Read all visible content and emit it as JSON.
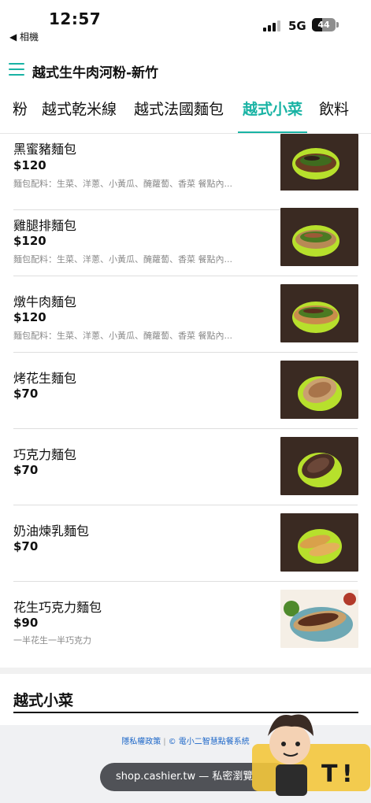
{
  "status_bar": {
    "time": "12:57",
    "back_label": "◀ 相機",
    "network": "5G",
    "battery": "44",
    "battery_level": 0.44
  },
  "header": {
    "title": "越式生牛肉河粉-新竹"
  },
  "tabs": [
    {
      "label": "粉",
      "active": false
    },
    {
      "label": "越式乾米線",
      "active": false
    },
    {
      "label": "越式法國麵包",
      "active": false
    },
    {
      "label": "越式小菜",
      "active": true
    },
    {
      "label": "飲料",
      "active": false
    }
  ],
  "items": [
    {
      "name": "黑蜜豬麵包",
      "price": "$120",
      "desc": "麵包配料：生菜、洋蔥、小黃瓜、醃蘿蔔、香菜 餐點內..."
    },
    {
      "name": "雞腿排麵包",
      "price": "$120",
      "desc": "麵包配料：生菜、洋蔥、小黃瓜、醃蘿蔔、香菜 餐點內..."
    },
    {
      "name": "燉牛肉麵包",
      "price": "$120",
      "desc": "麵包配料：生菜、洋蔥、小黃瓜、醃蘿蔔、香菜 餐點內..."
    },
    {
      "name": "烤花生麵包",
      "price": "$70",
      "desc": ""
    },
    {
      "name": "巧克力麵包",
      "price": "$70",
      "desc": ""
    },
    {
      "name": "奶油煉乳麵包",
      "price": "$70",
      "desc": ""
    },
    {
      "name": "花生巧克力麵包",
      "price": "$90",
      "desc": "一半花生一半巧克力"
    }
  ],
  "section": {
    "title": "越式小菜"
  },
  "footer": {
    "privacy_link": "隱私權政策",
    "separator": "|",
    "copyright": "© 電小二智慧點餐系統",
    "url_text": "shop.cashier.tw — 私密瀏覽"
  },
  "colors": {
    "accent": "#19b3a4",
    "link": "#1d67c8"
  }
}
